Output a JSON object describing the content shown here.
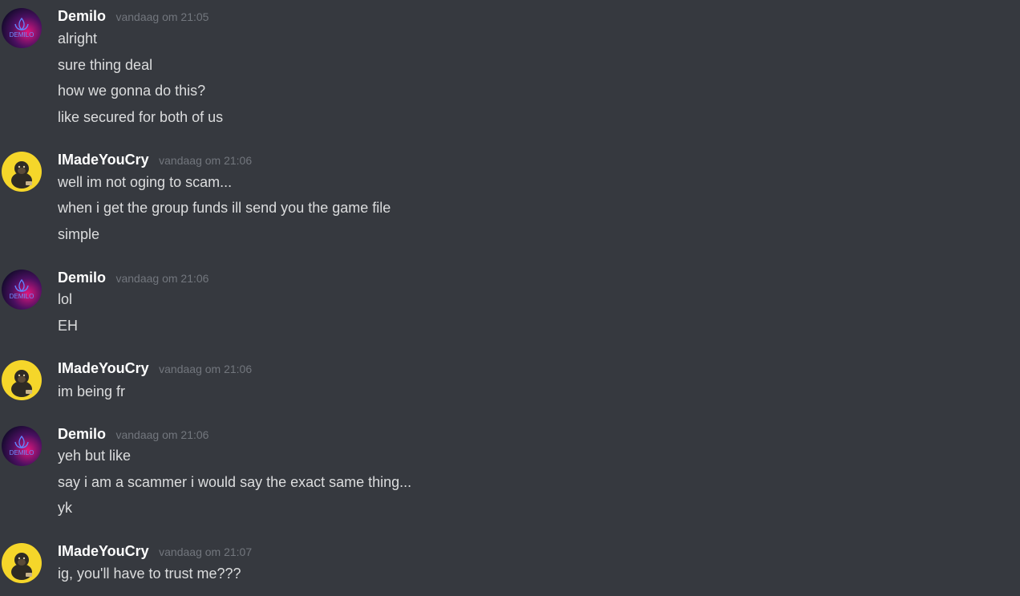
{
  "colors": {
    "background": "#36393f",
    "username": "#ffffff",
    "timestamp": "#72767d",
    "message_text": "#dcddde",
    "demilo_avatar_accent": "#e0167e",
    "imadeyoucry_avatar_bg": "#f5d62a"
  },
  "messages": [
    {
      "author": "Demilo",
      "avatar_icon": "demilo-logo-avatar-icon",
      "avatar_logo_text": "DEMILO",
      "timestamp": "vandaag om 21:05",
      "lines": [
        "alright",
        "sure thing deal",
        "how we gonna do this?",
        "like secured for both of us"
      ]
    },
    {
      "author": "IMadeYouCry",
      "avatar_icon": "gorilla-avatar-icon",
      "timestamp": "vandaag om 21:06",
      "lines": [
        "well im not oging to scam...",
        "when i get the group funds ill send you the game file",
        "simple"
      ]
    },
    {
      "author": "Demilo",
      "avatar_icon": "demilo-logo-avatar-icon",
      "avatar_logo_text": "DEMILO",
      "timestamp": "vandaag om 21:06",
      "lines": [
        "lol",
        "EH"
      ]
    },
    {
      "author": "IMadeYouCry",
      "avatar_icon": "gorilla-avatar-icon",
      "timestamp": "vandaag om 21:06",
      "lines": [
        "im being fr"
      ]
    },
    {
      "author": "Demilo",
      "avatar_icon": "demilo-logo-avatar-icon",
      "avatar_logo_text": "DEMILO",
      "timestamp": "vandaag om 21:06",
      "lines": [
        "yeh but like",
        "say i am a scammer i would say the exact same thing...",
        "yk"
      ]
    },
    {
      "author": "IMadeYouCry",
      "avatar_icon": "gorilla-avatar-icon",
      "timestamp": "vandaag om 21:07",
      "lines": [
        "ig, you'll have to trust me???"
      ]
    }
  ]
}
